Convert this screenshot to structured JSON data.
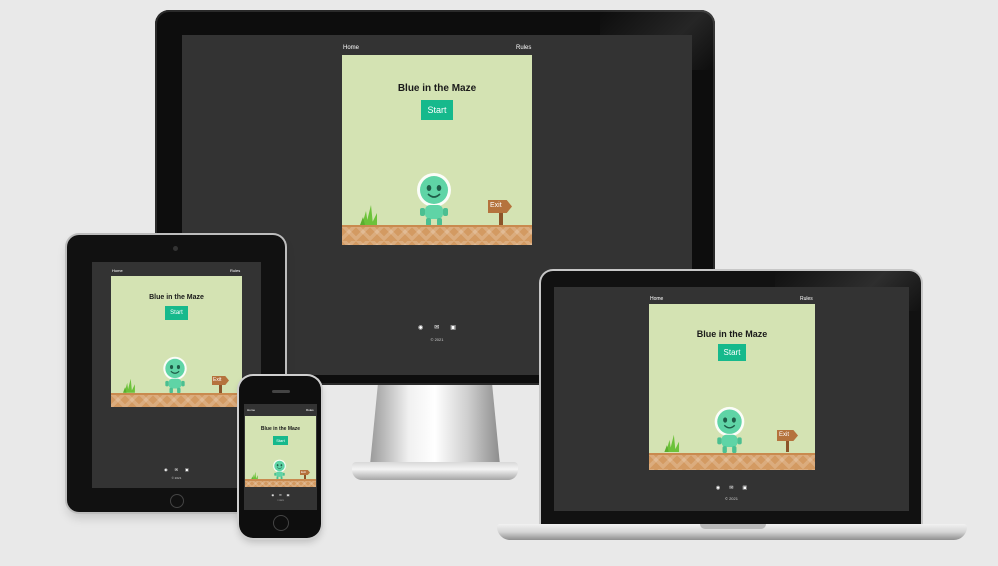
{
  "app": {
    "nav": {
      "home": "Home",
      "rules": "Rules"
    },
    "game": {
      "title": "Blue in the Maze",
      "start_label": "Start",
      "exit_sign": "Exit"
    },
    "footer": {
      "icons": [
        "github-icon",
        "email-icon",
        "linkedin-icon"
      ],
      "copyright": "© 2021"
    }
  },
  "colors": {
    "background": "#e9e9e9",
    "page_background": "#333333",
    "game_background": "#d4e3b3",
    "start_button": "#16b98c",
    "alien_body": "#5fd4a6",
    "ground": "#d39a62",
    "grass": "#6cc23a",
    "sign": "#b5733d"
  }
}
